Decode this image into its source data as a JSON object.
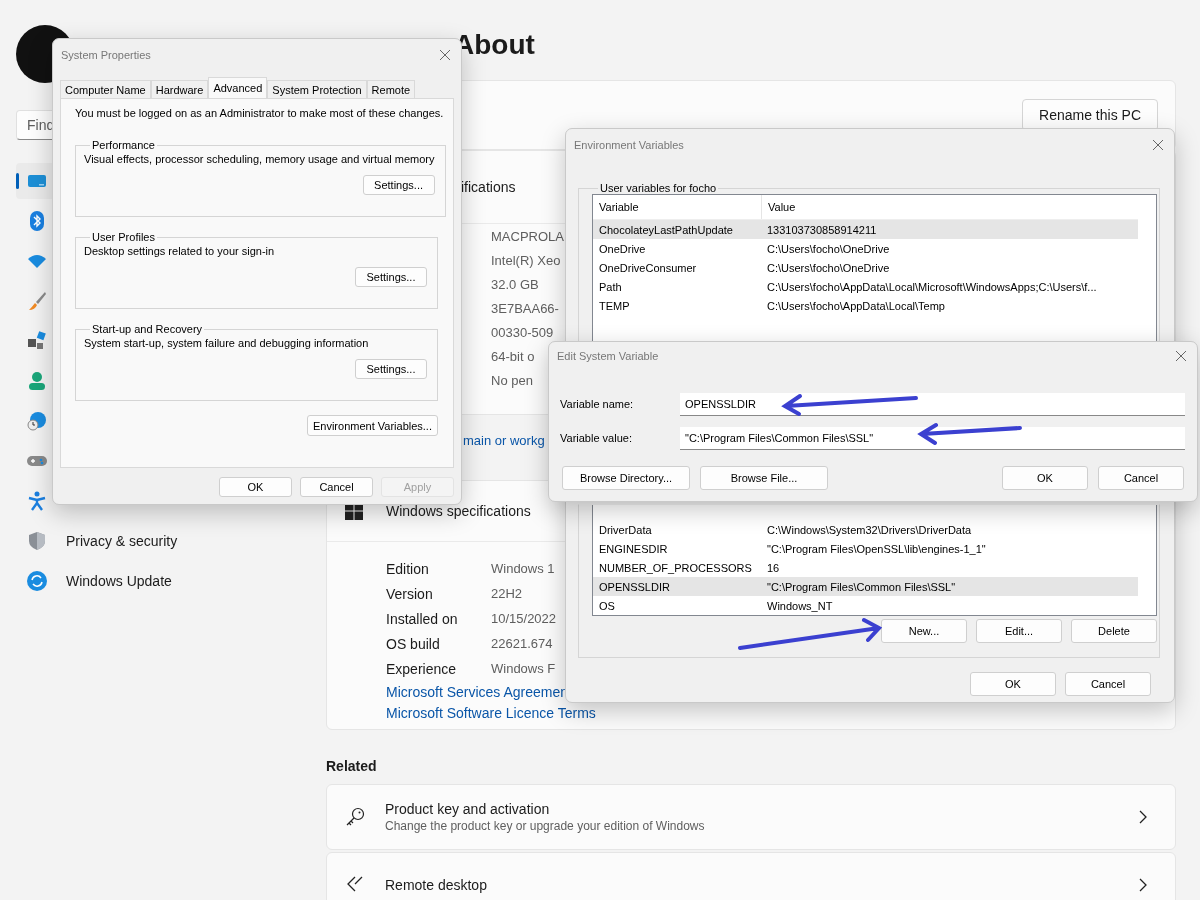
{
  "settings": {
    "search": {
      "placeholder": "Find"
    },
    "nav": [
      {
        "kind": "display",
        "selected": true
      },
      {
        "kind": "bluetooth",
        "selected": false
      },
      {
        "kind": "wifi",
        "selected": false
      },
      {
        "kind": "brush",
        "selected": false
      },
      {
        "kind": "apps",
        "selected": false
      },
      {
        "kind": "person",
        "selected": false
      },
      {
        "kind": "globe",
        "selected": false
      },
      {
        "kind": "gamepad",
        "selected": false
      },
      {
        "kind": "accessibility",
        "selected": false
      },
      {
        "kind": "shield",
        "label": "Privacy & security",
        "selected": false
      },
      {
        "kind": "update",
        "label": "Windows Update",
        "selected": false
      }
    ],
    "page_title": "About",
    "rename_button": "Rename this PC",
    "device_specs": {
      "heading": "ifications",
      "values": [
        "MACPROLA",
        "Intel(R) Xeo",
        "32.0 GB",
        "3E7BAA66-",
        "00330-509",
        "64-bit o",
        "No pen"
      ]
    },
    "domain_link": "main or workg",
    "windows_specs": {
      "heading": "Windows specifications",
      "rows": [
        {
          "label": "Edition",
          "value": "Windows 1"
        },
        {
          "label": "Version",
          "value": "22H2"
        },
        {
          "label": "Installed on",
          "value": "10/15/2022"
        },
        {
          "label": "OS build",
          "value": "22621.674"
        },
        {
          "label": "Experience",
          "value": "Windows F"
        }
      ],
      "links": [
        "Microsoft Services Agreemen",
        "Microsoft Software Licence Terms"
      ]
    },
    "related": {
      "heading": "Related",
      "items": [
        {
          "kind": "key",
          "title": "Product key and activation",
          "subtitle": "Change the product key or upgrade your edition of Windows"
        },
        {
          "kind": "remote",
          "title": "Remote desktop"
        }
      ]
    }
  },
  "system_properties": {
    "title": "System Properties",
    "tabs": [
      {
        "label": "Computer Name",
        "selected": false
      },
      {
        "label": "Hardware",
        "selected": false
      },
      {
        "label": "Advanced",
        "selected": true
      },
      {
        "label": "System Protection",
        "selected": false
      },
      {
        "label": "Remote",
        "selected": false
      }
    ],
    "notice": "You must be logged on as an Administrator to make most of these changes.",
    "groups": [
      {
        "title": "Performance",
        "description": "Visual effects, processor scheduling, memory usage and virtual memory",
        "button": "Settings..."
      },
      {
        "title": "User Profiles",
        "description": "Desktop settings related to your sign-in",
        "button": "Settings..."
      },
      {
        "title": "Start-up and Recovery",
        "description": "System start-up, system failure and debugging information",
        "button": "Settings..."
      }
    ],
    "env_button": "Environment Variables...",
    "buttons": [
      {
        "label": "OK",
        "disabled": false
      },
      {
        "label": "Cancel",
        "disabled": false
      },
      {
        "label": "Apply",
        "disabled": true
      }
    ]
  },
  "environment_variables": {
    "title": "Environment Variables",
    "user_group": "User variables for focho",
    "columns": [
      "Variable",
      "Value"
    ],
    "user_rows": [
      {
        "variable": "ChocolateyLastPathUpdate",
        "value": "133103730858914211",
        "selected": true
      },
      {
        "variable": "OneDrive",
        "value": "C:\\Users\\focho\\OneDrive",
        "selected": false
      },
      {
        "variable": "OneDriveConsumer",
        "value": "C:\\Users\\focho\\OneDrive",
        "selected": false
      },
      {
        "variable": "Path",
        "value": "C:\\Users\\focho\\AppData\\Local\\Microsoft\\WindowsApps;C:\\Users\\f...",
        "selected": false
      },
      {
        "variable": "TEMP",
        "value": "C:\\Users\\focho\\AppData\\Local\\Temp",
        "selected": false
      }
    ],
    "system_rows": [
      {
        "variable": "DriverData",
        "value": "C:\\Windows\\System32\\Drivers\\DriverData",
        "selected": false
      },
      {
        "variable": "ENGINESDIR",
        "value": "\"C:\\Program Files\\OpenSSL\\lib\\engines-1_1\"",
        "selected": false
      },
      {
        "variable": "NUMBER_OF_PROCESSORS",
        "value": "16",
        "selected": false
      },
      {
        "variable": "OPENSSLDIR",
        "value": "\"C:\\Program Files\\Common Files\\SSL\"",
        "selected": true
      },
      {
        "variable": "OS",
        "value": "Windows_NT",
        "selected": false
      }
    ],
    "system_buttons": [
      "New...",
      "Edit...",
      "Delete"
    ],
    "buttons": [
      "OK",
      "Cancel"
    ]
  },
  "edit_system_variable": {
    "title": "Edit System Variable",
    "fields": [
      {
        "label": "Variable name:",
        "value": "OPENSSLDIR"
      },
      {
        "label": "Variable value:",
        "value": "\"C:\\Program Files\\Common Files\\SSL\""
      }
    ],
    "left_buttons": [
      "Browse Directory...",
      "Browse File..."
    ],
    "buttons": [
      "OK",
      "Cancel"
    ]
  }
}
